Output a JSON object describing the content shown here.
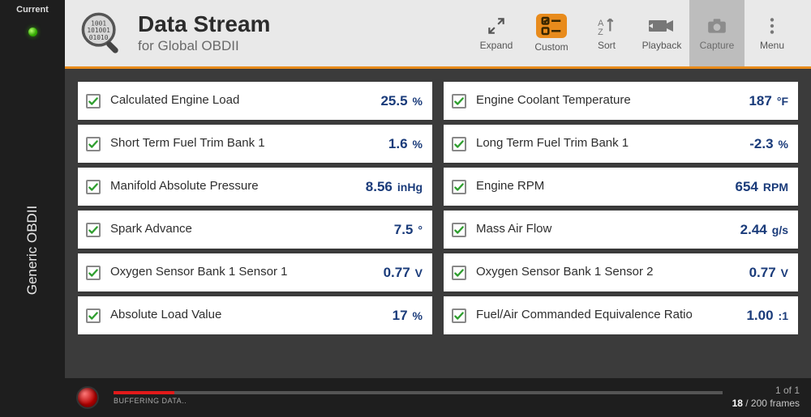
{
  "sidebar": {
    "current_label": "Current",
    "title": "Generic OBDII"
  },
  "header": {
    "title": "Data Stream",
    "subtitle": "for Global OBDII"
  },
  "toolbar": {
    "expand": "Expand",
    "custom": "Custom",
    "sort": "Sort",
    "playback": "Playback",
    "capture": "Capture",
    "menu": "Menu"
  },
  "left_col": [
    {
      "label": "Calculated Engine Load",
      "value": "25.5",
      "unit": "%"
    },
    {
      "label": "Short Term Fuel Trim Bank 1",
      "value": "1.6",
      "unit": "%"
    },
    {
      "label": "Manifold Absolute Pressure",
      "value": "8.56",
      "unit": "inHg"
    },
    {
      "label": "Spark Advance",
      "value": "7.5",
      "unit": "°"
    },
    {
      "label": "Oxygen Sensor Bank 1 Sensor 1",
      "value": "0.77",
      "unit": "V"
    },
    {
      "label": "Absolute Load Value",
      "value": "17",
      "unit": "%"
    }
  ],
  "right_col": [
    {
      "label": "Engine Coolant Temperature",
      "value": "187",
      "unit": "°F"
    },
    {
      "label": "Long Term Fuel Trim Bank 1",
      "value": "-2.3",
      "unit": "%"
    },
    {
      "label": "Engine RPM",
      "value": "654",
      "unit": "RPM"
    },
    {
      "label": "Mass Air Flow",
      "value": "2.44",
      "unit": "g/s"
    },
    {
      "label": "Oxygen Sensor Bank 1 Sensor 2",
      "value": "0.77",
      "unit": "V"
    },
    {
      "label": "Fuel/Air Commanded Equivalence Ratio",
      "value": "1.00",
      "unit": ":1"
    }
  ],
  "footer": {
    "buffering": "BUFFERING DATA..",
    "page": "1 of 1",
    "frames_current": "18",
    "frames_total": "/ 200",
    "frames_suffix": "frames"
  }
}
